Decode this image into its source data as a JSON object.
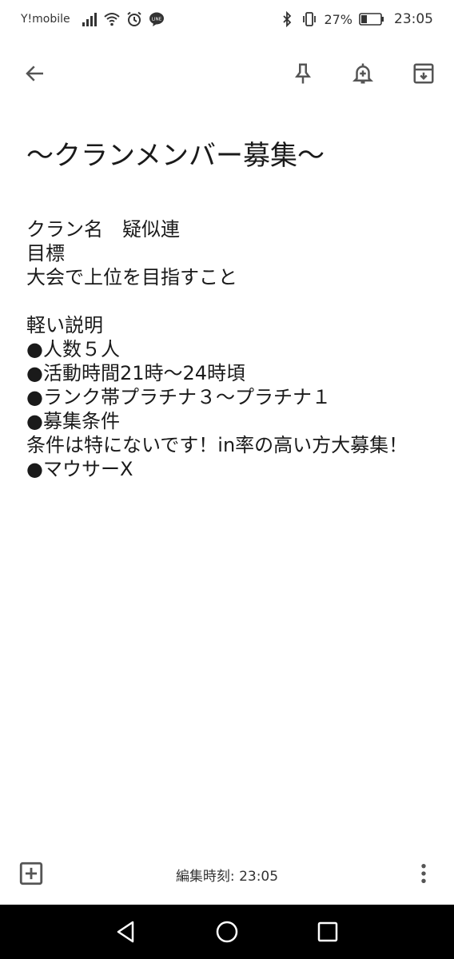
{
  "status_bar": {
    "carrier": "Y!mobile",
    "battery_percent": "27%",
    "time": "23:05",
    "icons": [
      "signal-icon",
      "wifi-icon",
      "alarm-icon",
      "line-app-icon",
      "bluetooth-icon",
      "vibrate-icon",
      "battery-icon"
    ]
  },
  "toolbar": {
    "icons": [
      "back-arrow-icon",
      "pin-icon",
      "reminder-bell-icon",
      "archive-icon"
    ]
  },
  "note": {
    "title": "～クランメンバー募集～",
    "lines": [
      "クラン名　疑似連",
      "目標",
      "大会で上位を目指すこと",
      "",
      "軽い説明",
      "●人数５人",
      "●活動時間21時～24時頃",
      "●ランク帯プラチナ３～プラチナ１",
      "●募集条件",
      "条件は特にないです！in率の高い方大募集！",
      "●マウサーX"
    ]
  },
  "bottom_bar": {
    "edited_label": "編集時刻: 23:05",
    "icons": [
      "add-box-icon",
      "more-vertical-icon"
    ]
  },
  "nav_bar": {
    "icons": [
      "nav-back-icon",
      "nav-home-icon",
      "nav-recents-icon"
    ],
    "background": "#000000"
  }
}
